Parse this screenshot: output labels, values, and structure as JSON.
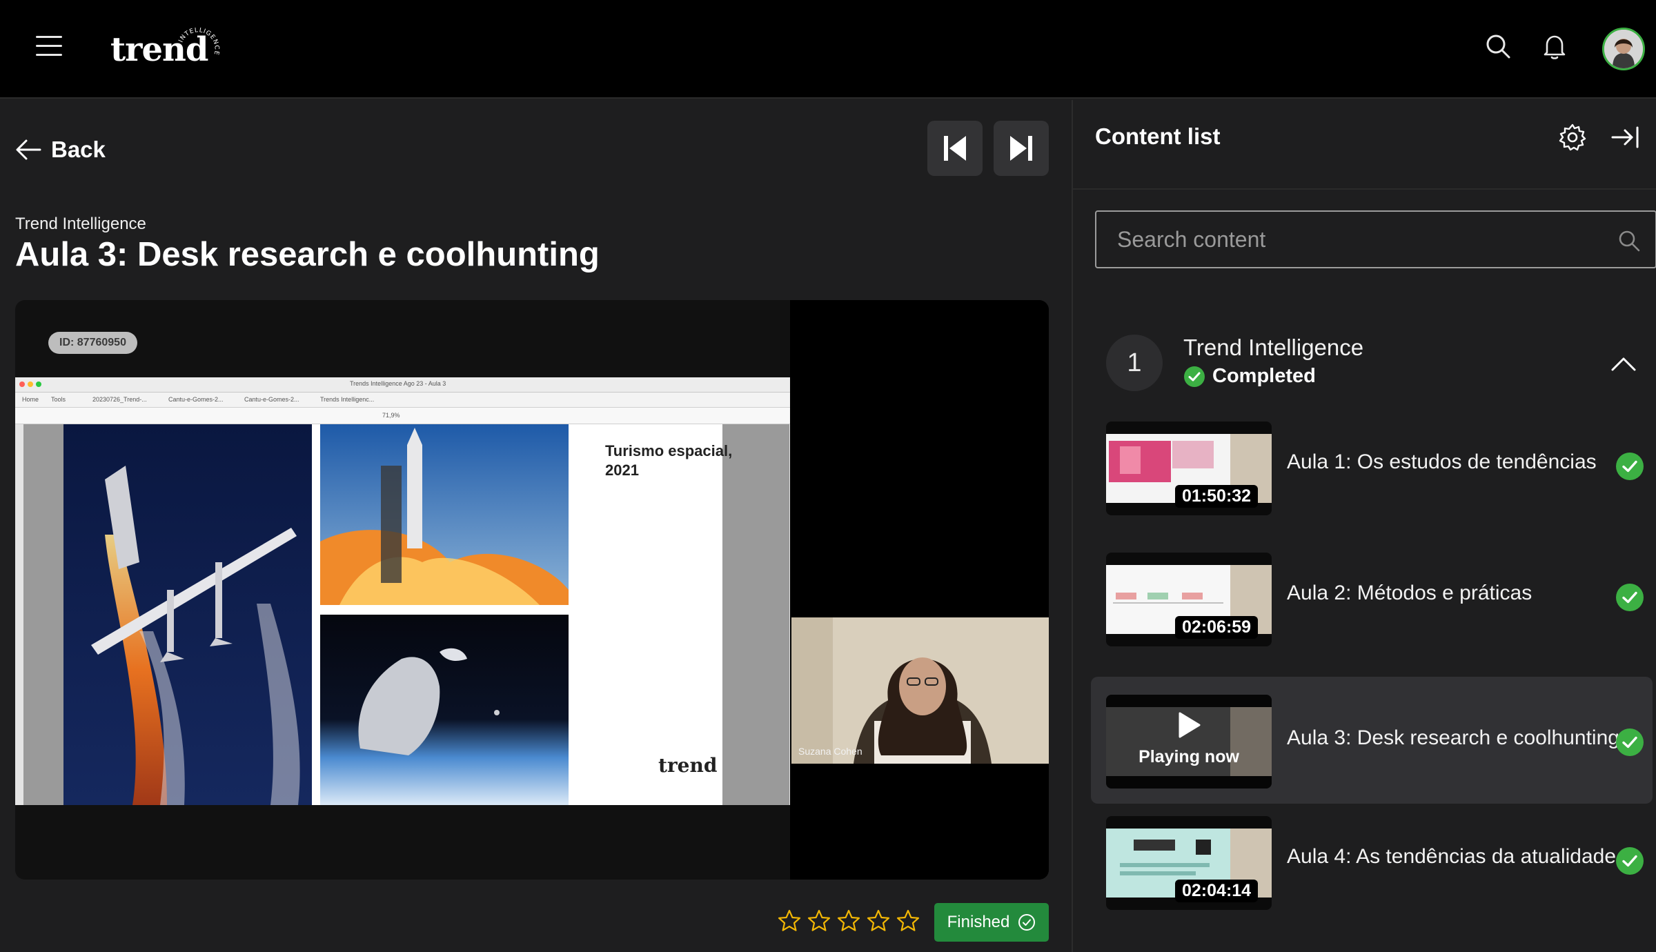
{
  "header": {
    "brand": "trend",
    "brand_arc": "INTELLIGENCE",
    "icons": [
      "menu-icon",
      "search-icon",
      "bell-icon",
      "avatar"
    ]
  },
  "lesson": {
    "back_label": "Back",
    "course": "Trend Intelligence",
    "title": "Aula 3: Desk research e coolhunting"
  },
  "video": {
    "id_badge": "ID: 87760950",
    "window_title": "Trends Intelligence Ago 23 - Aula 3",
    "tabs": [
      "Home",
      "Tools",
      "20230726_Trend-...",
      "Cantu-e-Gomes-2...",
      "Cantu-e-Gomes-2...",
      "Trends Intelligenc..."
    ],
    "zoom": "71,9%",
    "slide_title": "Turismo espacial, 2021",
    "slide_logo": "trend",
    "webcam_name": "Suzana Cohen"
  },
  "rating": {
    "max": 5,
    "value": 0
  },
  "finished_label": "Finished",
  "sidebar": {
    "title": "Content list",
    "search_placeholder": "Search content",
    "module": {
      "number": "1",
      "title": "Trend Intelligence",
      "status": "Completed"
    },
    "lessons": [
      {
        "title": "Aula 1: Os estudos de tendências",
        "duration": "01:50:32",
        "completed": true
      },
      {
        "title": "Aula 2: Métodos e práticas",
        "duration": "02:06:59",
        "completed": true
      },
      {
        "title": "Aula 3: Desk research e coolhunting",
        "status": "Playing now",
        "completed": true
      },
      {
        "title": "Aula 4: As tendências da atualidade",
        "duration": "02:04:14",
        "completed": true
      }
    ]
  },
  "colors": {
    "accent_green": "#238a3c",
    "check_green": "#3cb043",
    "star": "#f2b705",
    "background": "#1e1e1f"
  }
}
